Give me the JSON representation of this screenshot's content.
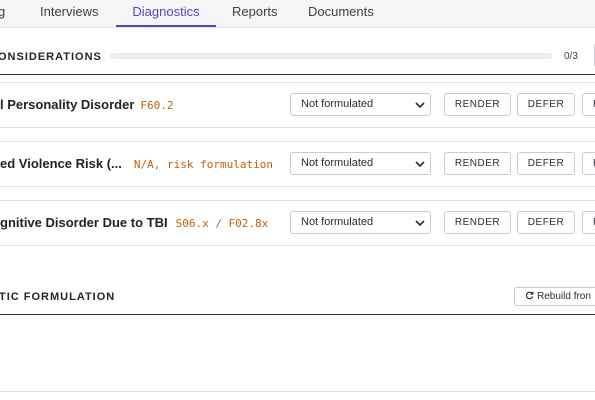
{
  "tabs": [
    {
      "label": "g",
      "active": false
    },
    {
      "label": "Interviews",
      "active": false
    },
    {
      "label": "Diagnostics",
      "active": true
    },
    {
      "label": "Reports",
      "active": false
    },
    {
      "label": "Documents",
      "active": false
    }
  ],
  "considerations": {
    "title": "ONSIDERATIONS",
    "progress_fraction": 0,
    "count": "0/3"
  },
  "rows": [
    {
      "name": "l Personality Disorder",
      "code": "F60.2",
      "status": "Not formulated"
    },
    {
      "name": "ed Violence Risk (...",
      "code": "N/A, risk formulation",
      "status": "Not formulated"
    },
    {
      "name": "gnitive Disorder Due to TBI",
      "code": "S06.x / F02.8x",
      "status": "Not formulated"
    }
  ],
  "row_buttons": {
    "render": "RENDER",
    "defer": "DEFER",
    "third": "R"
  },
  "formulation": {
    "title": "TIC FORMULATION",
    "rebuild_label": "Rebuild fron"
  },
  "colors": {
    "accent": "#5b3fc4",
    "code": "#c0620b"
  }
}
